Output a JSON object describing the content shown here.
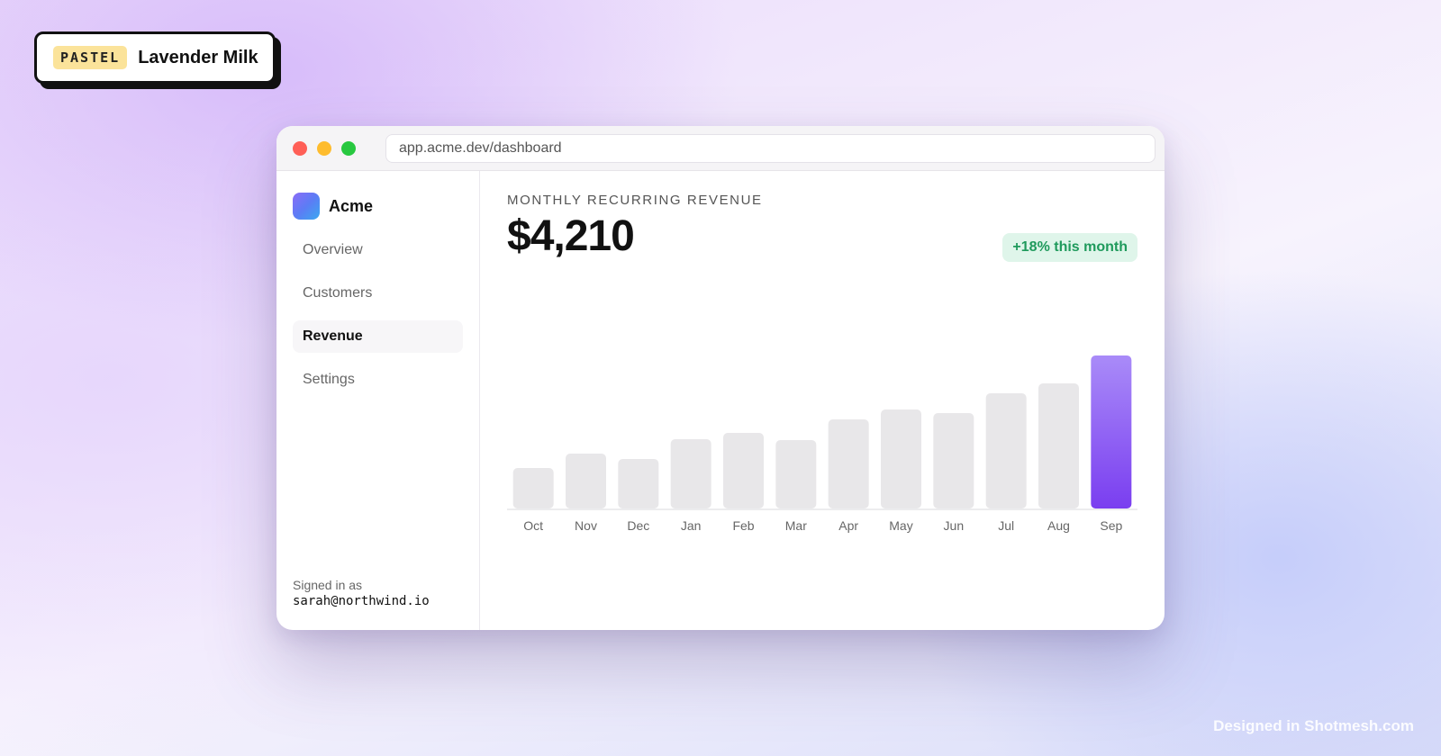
{
  "badge": {
    "tag": "PASTEL",
    "name": "Lavender Milk"
  },
  "window": {
    "url": "app.acme.dev/dashboard",
    "traffic_lights": [
      "close",
      "minimize",
      "maximize"
    ]
  },
  "sidebar": {
    "brand": "Acme",
    "items": [
      {
        "label": "Overview",
        "active": false
      },
      {
        "label": "Customers",
        "active": false
      },
      {
        "label": "Revenue",
        "active": true
      },
      {
        "label": "Settings",
        "active": false
      }
    ],
    "signed_in_label": "Signed in as",
    "signed_in_email": "sarah@northwind.io"
  },
  "main": {
    "metric_label": "MONTHLY RECURRING REVENUE",
    "metric_value": "$4,210",
    "delta": "+18% this month"
  },
  "chart_data": {
    "type": "bar",
    "categories": [
      "Oct",
      "Nov",
      "Dec",
      "Jan",
      "Feb",
      "Mar",
      "Apr",
      "May",
      "Jun",
      "Jul",
      "Aug",
      "Sep"
    ],
    "values": [
      45,
      61,
      55,
      77,
      84,
      76,
      99,
      110,
      106,
      128,
      139,
      170
    ],
    "highlight_index": 11,
    "title": "",
    "xlabel": "",
    "ylabel": "",
    "ylim": [
      0,
      170
    ],
    "grid": false,
    "colors": {
      "bar": "#e8e7e9",
      "highlight_top": "#a98bf8",
      "highlight_bottom": "#7a3ef0",
      "baseline": "#ececee",
      "tick": "#666666"
    }
  },
  "watermark": "Designed in Shotmesh.com"
}
